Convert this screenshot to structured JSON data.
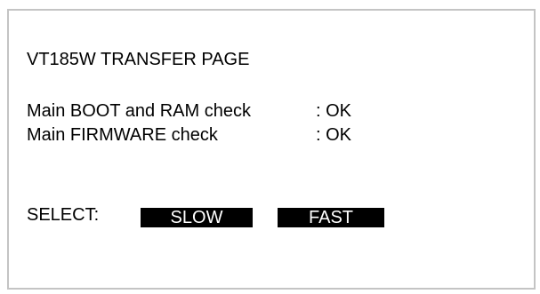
{
  "page": {
    "title": "VT185W TRANSFER PAGE"
  },
  "checks": [
    {
      "label": "Main BOOT and RAM check",
      "status": ": OK"
    },
    {
      "label": "Main FIRMWARE check",
      "status": ": OK"
    }
  ],
  "select": {
    "label": "SELECT:",
    "options": [
      {
        "label": "SLOW"
      },
      {
        "label": "FAST"
      }
    ]
  },
  "colors": {
    "frame_border": "#c4c4c4",
    "button_bg": "#000000",
    "button_text": "#ffffff",
    "text": "#000000"
  }
}
